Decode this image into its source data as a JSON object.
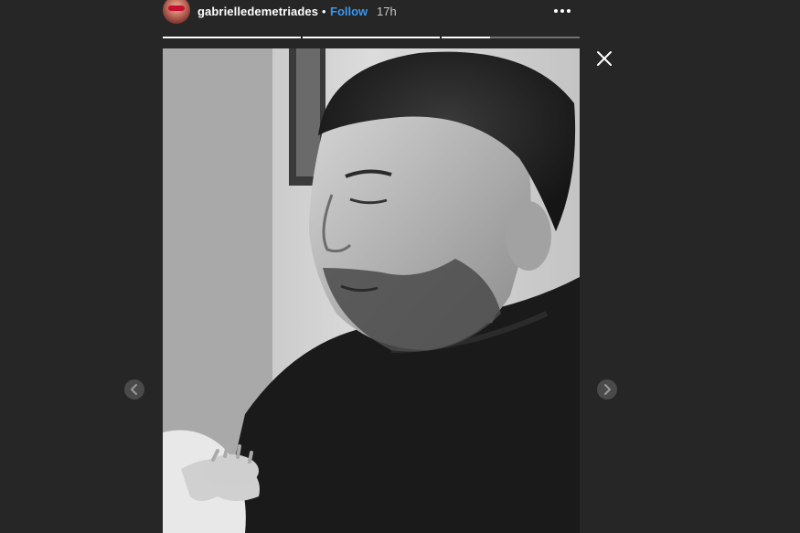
{
  "story": {
    "username": "gabrielledemetriades",
    "separator": "•",
    "follow_label": "Follow",
    "timestamp": "17h",
    "more_icon": "more-horizontal-icon",
    "close_icon": "close-icon",
    "prev_icon": "chevron-left-icon",
    "next_icon": "chevron-right-icon",
    "progress_segments": [
      1,
      1,
      0.35
    ],
    "image": "black-and-white-photo-man-looking-at-baby"
  },
  "colors": {
    "background": "#262626",
    "follow": "#3897f0",
    "text": "#ffffff",
    "muted": "#c7c7c7"
  }
}
